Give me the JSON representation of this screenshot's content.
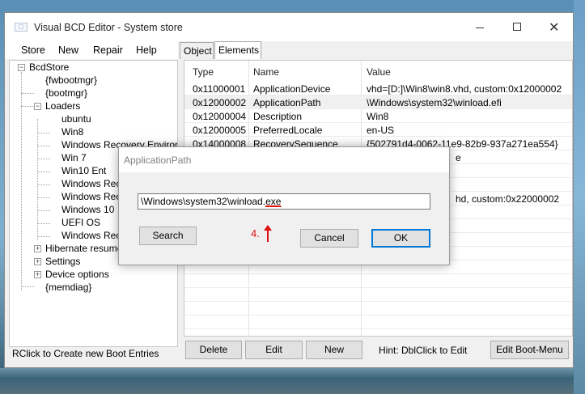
{
  "window": {
    "title": "Visual BCD Editor - System store",
    "icon": "app-icon"
  },
  "menu": [
    "Store",
    "New",
    "Repair",
    "Help"
  ],
  "tree": {
    "root": "BcdStore",
    "items": [
      "{fwbootmgr}",
      "{bootmgr}",
      "Loaders",
      "ubuntu",
      "Win8",
      "Windows Recovery Environme",
      "Win 7",
      "Win10 Ent",
      "Windows Recov",
      "Windows Recov",
      "Windows 10",
      "UEFI OS",
      "Windows Recov",
      "Hibernate resumers",
      "Settings",
      "Device options",
      "{memdiag}"
    ],
    "selected": "Win8"
  },
  "status_text": "RClick to Create new Boot Entries",
  "tabs": [
    {
      "label": "Object",
      "active": false
    },
    {
      "label": "Elements",
      "active": true
    }
  ],
  "grid": {
    "headers": [
      "Type",
      "Name",
      "Value"
    ],
    "rows": [
      {
        "type": "0x11000001",
        "name": "ApplicationDevice",
        "value": "vhd=[D:]\\Win8\\win8.vhd, custom:0x12000002",
        "selected": false
      },
      {
        "type": "0x12000002",
        "name": "ApplicationPath",
        "value": "\\Windows\\system32\\winload.efi",
        "selected": true
      },
      {
        "type": "0x12000004",
        "name": "Description",
        "value": "Win8",
        "selected": false
      },
      {
        "type": "0x12000005",
        "name": "PreferredLocale",
        "value": "en-US",
        "selected": false
      },
      {
        "type": "0x14000008",
        "name": "RecoverySequence",
        "value": "{502791d4-0062-11e9-82b9-937a271ea554}",
        "selected": false
      }
    ],
    "partial_values": [
      "e",
      "hd, custom:0x22000002"
    ]
  },
  "buttons": {
    "delete": "Delete",
    "edit": "Edit",
    "new": "New",
    "edit_boot_menu": "Edit Boot-Menu"
  },
  "hint": "Hint: DblClick to Edit",
  "dialog": {
    "title": "ApplicationPath",
    "input_prefix": "\\Windows\\system32\\winload.",
    "input_marked": "exe",
    "search": "Search",
    "cancel": "Cancel",
    "ok": "OK",
    "annotation": "4."
  },
  "colors": {
    "annotation": "#e01010",
    "focus": "#0078d7"
  }
}
